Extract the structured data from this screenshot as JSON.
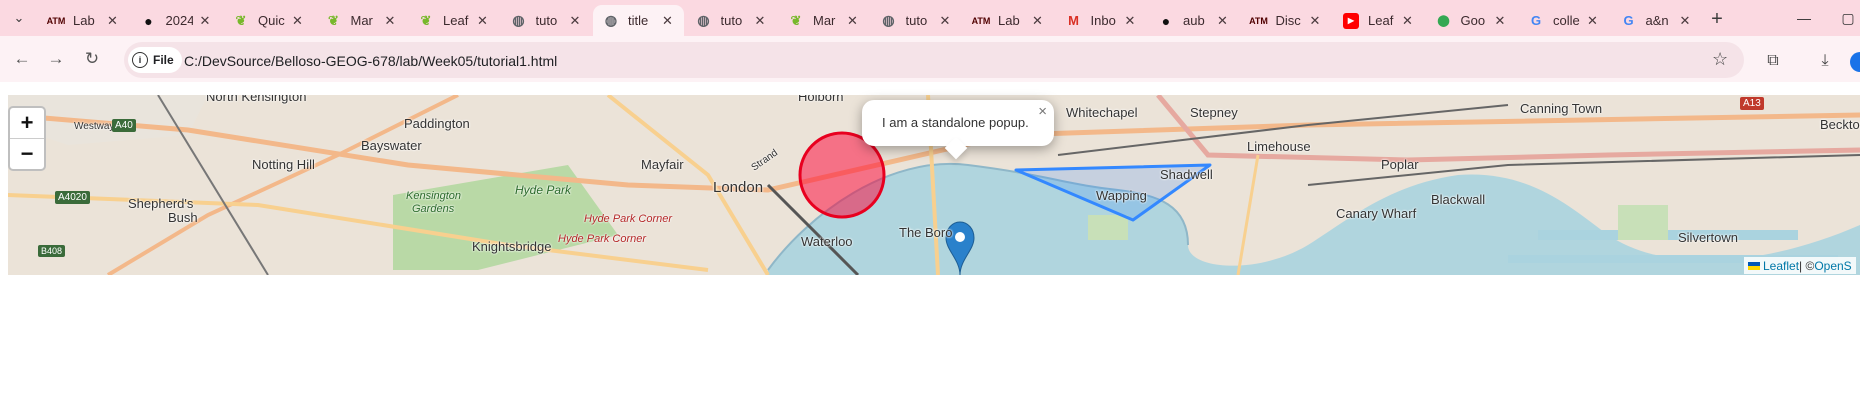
{
  "tabs": [
    {
      "title": "Lab",
      "icon": "tamu-icon",
      "active": false
    },
    {
      "title": "2024",
      "icon": "github-icon",
      "active": false
    },
    {
      "title": "Quic",
      "icon": "leaflet-icon",
      "active": false
    },
    {
      "title": "Mar",
      "icon": "leaflet-icon",
      "active": false
    },
    {
      "title": "Leaf",
      "icon": "leaflet-icon",
      "active": false
    },
    {
      "title": "tuto",
      "icon": "globe-icon",
      "active": false
    },
    {
      "title": "title",
      "icon": "globe-icon",
      "active": true
    },
    {
      "title": "tuto",
      "icon": "globe-icon",
      "active": false
    },
    {
      "title": "Mar",
      "icon": "leaflet-icon",
      "active": false
    },
    {
      "title": "tuto",
      "icon": "globe-icon",
      "active": false
    },
    {
      "title": "Lab",
      "icon": "tamu-icon",
      "active": false
    },
    {
      "title": "Inbo",
      "icon": "gmail-icon",
      "active": false
    },
    {
      "title": "aub",
      "icon": "github-icon",
      "active": false
    },
    {
      "title": "Disc",
      "icon": "tamu-icon",
      "active": false
    },
    {
      "title": "Leaf",
      "icon": "youtube-icon",
      "active": false
    },
    {
      "title": "Goo",
      "icon": "maps-icon",
      "active": false
    },
    {
      "title": "colle",
      "icon": "google-icon",
      "active": false
    },
    {
      "title": "a&n",
      "icon": "google-icon",
      "active": false
    }
  ],
  "toolbar": {
    "chip_label": "File",
    "url": "C:/DevSource/Belloso-GEOG-678/lab/Week05/tutorial1.html"
  },
  "map": {
    "zoom_in": "+",
    "zoom_out": "−",
    "popup_text": "I am a standalone popup.",
    "popup_close": "×",
    "attribution": {
      "leaflet": "Leaflet",
      "sep": " | © ",
      "osm": "OpenS"
    },
    "circle_color": "#f03",
    "polygon_color": "#3388ff",
    "places": {
      "north_kensington": "North Kensington",
      "holborn": "Holborn",
      "whitechapel": "Whitechapel",
      "stepney": "Stepney",
      "canning_town": "Canning Town",
      "paddington": "Paddington",
      "bayswater": "Bayswater",
      "limehouse": "Limehouse",
      "beckton": "Beckton",
      "notting_hill": "Notting Hill",
      "mayfair": "Mayfair",
      "poplar": "Poplar",
      "shadwell": "Shadwell",
      "london": "London",
      "wapping": "Wapping",
      "blackwall": "Blackwall",
      "shepherds_bush_1": "Shepherd's",
      "shepherds_bush_2": "Bush",
      "kensington_gardens_1": "Kensington",
      "kensington_gardens_2": "Gardens",
      "hyde_park": "Hyde Park",
      "hyde_park_corner_1": "Hyde Park Corner",
      "hyde_park_corner_2": "Hyde Park Corner",
      "canary_wharf": "Canary Wharf",
      "the_borough": "The Boro",
      "waterloo": "Waterloo",
      "knightsbridge": "Knightsbridge",
      "silvertown": "Silvertown",
      "westway": "Westway",
      "a40": "A40",
      "a4020": "A4020",
      "a13": "A13",
      "b408": "B408",
      "strand": "Strand"
    }
  }
}
